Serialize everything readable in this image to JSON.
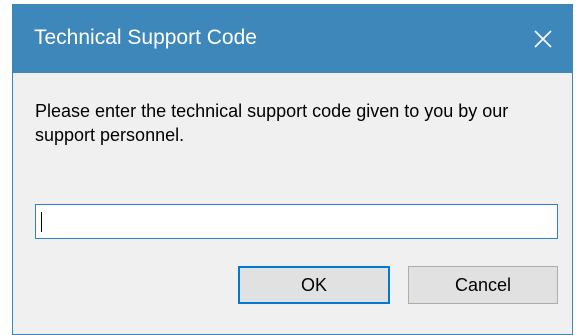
{
  "dialog": {
    "title": "Technical Support Code",
    "message": "Please enter the technical support code given to you by our support personnel.",
    "input_value": "",
    "ok_label": "OK",
    "cancel_label": "Cancel"
  },
  "colors": {
    "titlebar": "#3e87bb",
    "dialog_background": "#f0f0f0",
    "button_background": "#e1e1e1",
    "focus_accent": "#0078d7"
  },
  "icons": {
    "close": "close-icon"
  }
}
